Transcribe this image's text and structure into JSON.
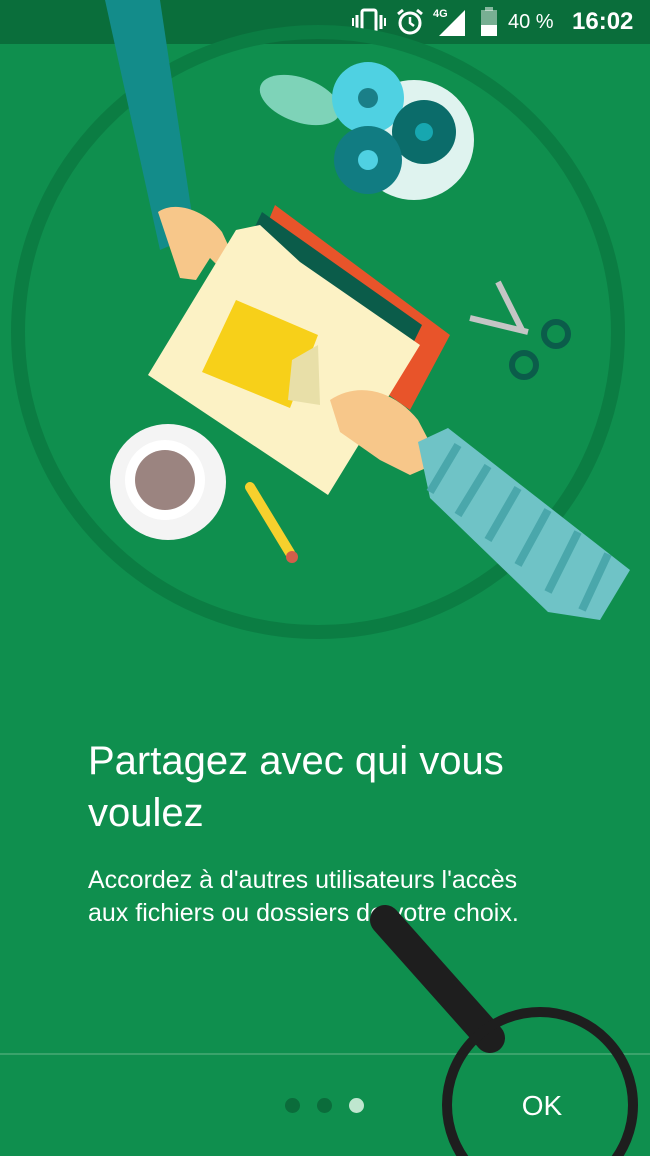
{
  "status_bar": {
    "icons": [
      "vibrate-icon",
      "alarm-icon",
      "network-4g-signal-icon",
      "battery-icon"
    ],
    "network_label": "4G",
    "battery": "40 %",
    "time": "16:02"
  },
  "onboarding": {
    "title": "Partagez avec qui vous voulez",
    "description": "Accordez à d'autres utilisateurs l'accès aux fichiers ou dossiers de votre choix.",
    "illustration": "folder-sharing-illustration",
    "page_count": 3,
    "current_page": 3,
    "ok_label": "OK"
  },
  "colors": {
    "background": "#0f8f4e",
    "status_bar": "#0a6e3b",
    "dot_active": "#bfe6cf",
    "dot_inactive": "#0b6c3b"
  }
}
